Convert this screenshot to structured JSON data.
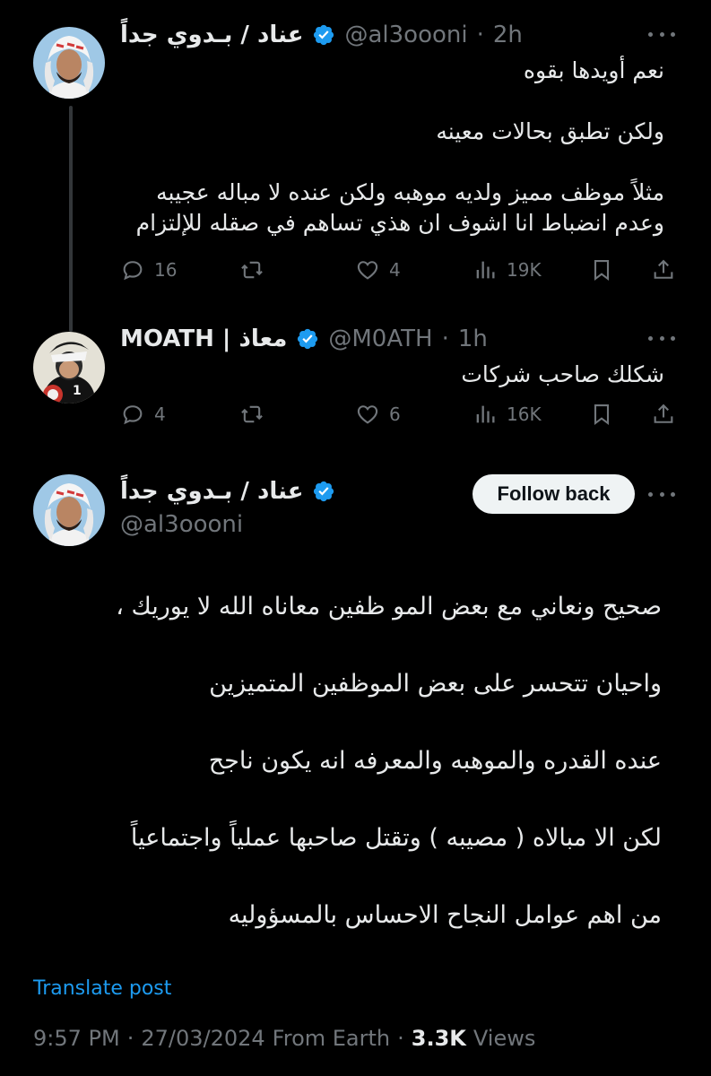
{
  "thread_line_color": "#333639",
  "accent_color": "#1d9bf0",
  "reply1": {
    "display_name": "عناد / بـدوي جداً",
    "handle": "@al3oooni",
    "time": "2h",
    "verified_icon": "verified-badge-icon",
    "paragraphs": [
      [
        "نعم أويدها بقوه"
      ],
      [
        "ولكن تطبق بحالات معينه"
      ],
      [
        "مثلاً موظف مميز ولديه موهبه ولكن عنده لا مباله عجيبه",
        "وعدم انضباط انا اشوف ان هذي تساهم في صقله للإلتزام"
      ]
    ],
    "stats": {
      "replies": "16",
      "reposts": "",
      "likes": "4",
      "views": "19K"
    }
  },
  "reply2": {
    "display_name": "MOATH | معاذ",
    "handle": "@M0ATH",
    "time": "1h",
    "verified_icon": "verified-badge-icon",
    "paragraphs": [
      [
        "شكلك صاحب شركات"
      ]
    ],
    "stats": {
      "replies": "4",
      "reposts": "",
      "likes": "6",
      "views": "16K"
    }
  },
  "main": {
    "display_name": "عناد / بـدوي جداً",
    "handle": "@al3oooni",
    "follow_label": "Follow back",
    "lines": [
      "صحيح ونعاني مع بعض المو ظفين معاناه الله لا يوريك ،",
      "واحيان تتحسر على بعض الموظفين المتميزين",
      "عنده القدره والموهبه والمعرفه انه يكون ناجح",
      "لكن الا مبالاه ( مصيبه ) وتقتل صاحبها عملياً واجتماعياً",
      "من اهم عوامل النجاح الاحساس بالمسؤوليه"
    ],
    "translate_label": "Translate post",
    "time": "9:57 PM",
    "date": "27/03/2024",
    "source": "From Earth",
    "views_count": "3.3K",
    "views_label": "Views"
  },
  "icons": [
    "reply-icon",
    "repost-icon",
    "like-icon",
    "views-icon",
    "bookmark-icon",
    "share-icon",
    "more-icon"
  ]
}
